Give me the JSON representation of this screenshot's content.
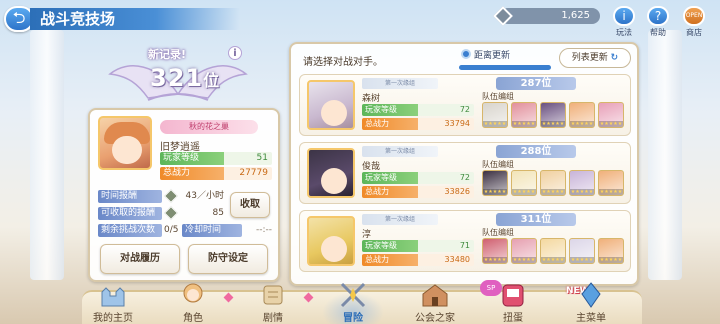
{
  "header": {
    "back_label": "⮌",
    "title": "战斗竞技场",
    "currency_value": "1,625",
    "icons": [
      {
        "name": "help-info",
        "glyph": "i",
        "label": "玩法"
      },
      {
        "name": "help",
        "glyph": "?",
        "label": "帮助"
      },
      {
        "name": "shop",
        "glyph": "OPEN",
        "label": "商店"
      }
    ]
  },
  "record": {
    "new_record_label": "新记录!",
    "rank": "321",
    "rank_unit": "位",
    "info_glyph": "i"
  },
  "player": {
    "frame_badge": "秋的花之巢",
    "name": "旧梦逍遥",
    "level_label": "玩家等级",
    "level": "51",
    "power_label": "总战力",
    "power": "27779",
    "hourly_label": "时间报酬",
    "hourly_value": "43／小时",
    "collectable_label": "可收取的报酬",
    "collectable_value": "85",
    "collect_button": "收取",
    "challenges_label": "剩余挑战次数",
    "challenges_value": "0/5",
    "cooldown_label": "冷却时间",
    "cooldown_value": "--:--",
    "history_button": "对战履历",
    "defense_button": "防守设定"
  },
  "opponents_panel": {
    "prompt": "请选择对战对手。",
    "sort_label": "距离更新",
    "refresh_label": "列表更新",
    "team_label": "队伍编组",
    "level_label": "玩家等级",
    "power_label": "总战力",
    "list": [
      {
        "badge": "第一次缘组",
        "name": "森树",
        "level": "72",
        "power": "33794",
        "rank": "287位",
        "team_colors": [
          "#d8d4cc",
          "#e2909c",
          "#6a5080",
          "#f0b07a",
          "#e8a0b8"
        ]
      },
      {
        "badge": "第一次缘组",
        "name": "俊哉",
        "level": "72",
        "power": "33826",
        "rank": "288位",
        "team_colors": [
          "#3c3042",
          "#f2e4b8",
          "#f0d0a0",
          "#c8b4d8",
          "#f0b07a"
        ]
      },
      {
        "badge": "第一次缘组",
        "name": "淳",
        "level": "71",
        "power": "33480",
        "rank": "311位",
        "team_colors": [
          "#d06070",
          "#e6a0b0",
          "#f4d8a0",
          "#dcd6e8",
          "#f0b07a"
        ]
      }
    ]
  },
  "bottom_nav": [
    {
      "label": "我的主页",
      "icon": "castle-icon",
      "color": "#9fc4e8"
    },
    {
      "label": "角色",
      "icon": "character-icon",
      "color": "#f0c080"
    },
    {
      "label": "剧情",
      "icon": "scroll-icon",
      "color": "#e8d2a8"
    },
    {
      "label": "冒险",
      "icon": "swords-icon",
      "color": "#a8b8d0",
      "active": true
    },
    {
      "label": "公会之家",
      "icon": "guild-house-icon",
      "color": "#d09060"
    },
    {
      "label": "扭蛋",
      "icon": "gacha-icon",
      "color": "#e05070",
      "tag": "SP"
    },
    {
      "label": "主菜单",
      "icon": "crystal-icon",
      "color": "#5aa0e0",
      "tag": "NEW"
    }
  ],
  "colors": {
    "accent_blue": "#2e74c9",
    "level_green": "#5db65a",
    "power_orange": "#f08a28",
    "card_border": "#d8c8a8"
  }
}
